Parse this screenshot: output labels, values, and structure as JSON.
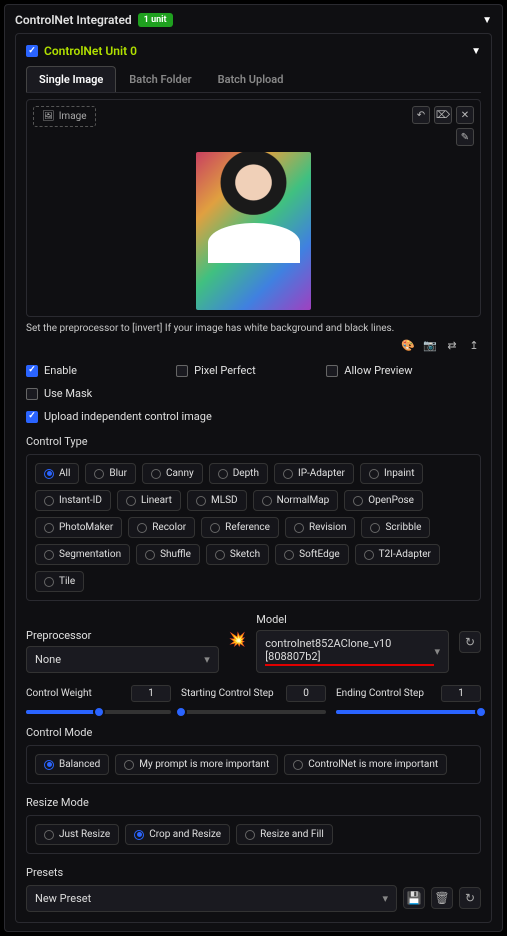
{
  "header": {
    "title": "ControlNet Integrated",
    "badge": "1 unit"
  },
  "unit": {
    "title": "ControlNet Unit 0",
    "tabs": [
      "Single Image",
      "Batch Folder",
      "Batch Upload"
    ],
    "active_tab": 0,
    "image_btn": "Image",
    "hint": "Set the preprocessor to [invert] If your image has white background and black lines."
  },
  "toggles": {
    "enable": "Enable",
    "pixel_perfect": "Pixel Perfect",
    "allow_preview": "Allow Preview",
    "use_mask": "Use Mask",
    "upload_independent": "Upload independent control image"
  },
  "control_type": {
    "label": "Control Type",
    "selected": "All",
    "options": [
      "All",
      "Blur",
      "Canny",
      "Depth",
      "IP-Adapter",
      "Inpaint",
      "Instant-ID",
      "Lineart",
      "MLSD",
      "NormalMap",
      "OpenPose",
      "PhotoMaker",
      "Recolor",
      "Reference",
      "Revision",
      "Scribble",
      "Segmentation",
      "Shuffle",
      "Sketch",
      "SoftEdge",
      "T2I-Adapter",
      "Tile"
    ]
  },
  "preprocessor": {
    "label": "Preprocessor",
    "value": "None"
  },
  "model": {
    "label": "Model",
    "value": "controlnet852AClone_v10 [808807b2]"
  },
  "sliders": {
    "weight": {
      "label": "Control Weight",
      "value": 1,
      "pct": 50
    },
    "start": {
      "label": "Starting Control Step",
      "value": 0,
      "pct": 0
    },
    "end": {
      "label": "Ending Control Step",
      "value": 1,
      "pct": 100
    }
  },
  "control_mode": {
    "label": "Control Mode",
    "selected": "Balanced",
    "options": [
      "Balanced",
      "My prompt is more important",
      "ControlNet is more important"
    ]
  },
  "resize_mode": {
    "label": "Resize Mode",
    "selected": "Crop and Resize",
    "options": [
      "Just Resize",
      "Crop and Resize",
      "Resize and Fill"
    ]
  },
  "presets": {
    "label": "Presets",
    "value": "New Preset"
  }
}
